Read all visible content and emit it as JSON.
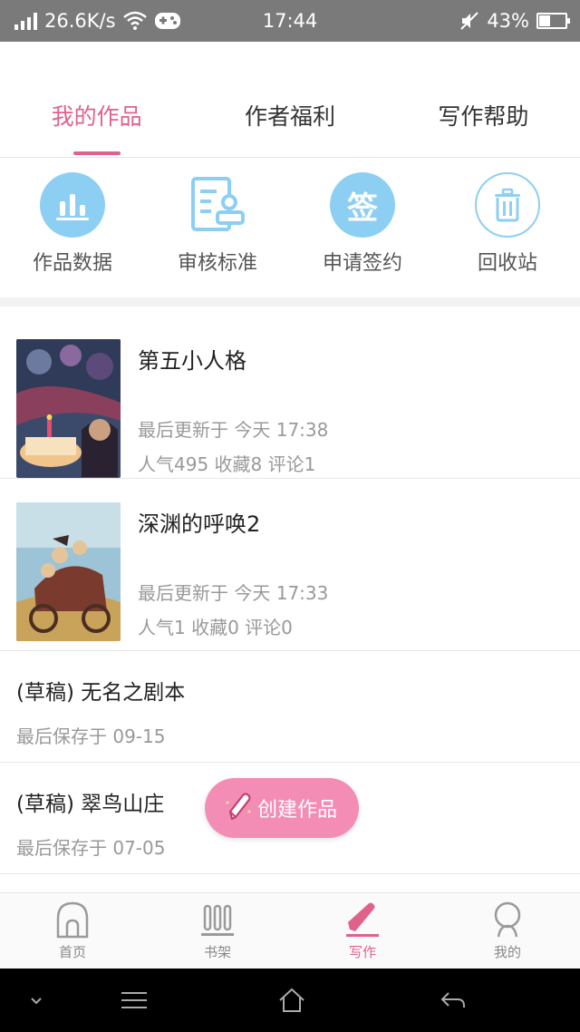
{
  "status_bar": {
    "net_speed": "26.6K/s",
    "time": "17:44",
    "battery": "43%",
    "battery_level": 0.43,
    "icons": [
      "signal-icon",
      "wifi-icon",
      "gamepad-icon",
      "mute-icon",
      "battery-icon"
    ]
  },
  "tabs": [
    {
      "label": "我的作品",
      "active": true
    },
    {
      "label": "作者福利",
      "active": false
    },
    {
      "label": "写作帮助",
      "active": false
    }
  ],
  "quick_actions": [
    {
      "label": "作品数据",
      "icon": "bar-chart-icon"
    },
    {
      "label": "审核标准",
      "icon": "review-document-icon"
    },
    {
      "label": "申请签约",
      "icon": "sign-icon",
      "glyph": "签"
    },
    {
      "label": "回收站",
      "icon": "trash-icon"
    }
  ],
  "works": [
    {
      "title": "第五小人格",
      "updated": "最后更新于 今天 17:38",
      "stats": "人气495 收藏8 评论1",
      "cover_colors": [
        "#3b4a6b",
        "#8a3f5c",
        "#f0c48a"
      ]
    },
    {
      "title": "深渊的呼唤2",
      "updated": "最后更新于 今天 17:33",
      "stats": "人气1 收藏0 评论0",
      "cover_colors": [
        "#7fb0c8",
        "#c9a35a",
        "#7a3b2e"
      ]
    }
  ],
  "drafts": [
    {
      "title": "(草稿) 无名之剧本",
      "saved": "最后保存于 09-15"
    },
    {
      "title": "(草稿) 翠鸟山庄",
      "saved": "最后保存于 07-05"
    }
  ],
  "create_button": {
    "label": "创建作品",
    "icon": "pencil-icon"
  },
  "bottom_nav": [
    {
      "label": "首页",
      "icon": "home-arch-icon",
      "active": false
    },
    {
      "label": "书架",
      "icon": "bookshelf-icon",
      "active": false
    },
    {
      "label": "写作",
      "icon": "pencil-icon",
      "active": true
    },
    {
      "label": "我的",
      "icon": "user-icon",
      "active": false
    }
  ],
  "system_nav": [
    "collapse-icon",
    "menu-icon",
    "home-icon",
    "back-icon"
  ],
  "colors": {
    "accent": "#e0628b",
    "icon_blue": "#8dcff3",
    "fab": "#f48db6"
  }
}
